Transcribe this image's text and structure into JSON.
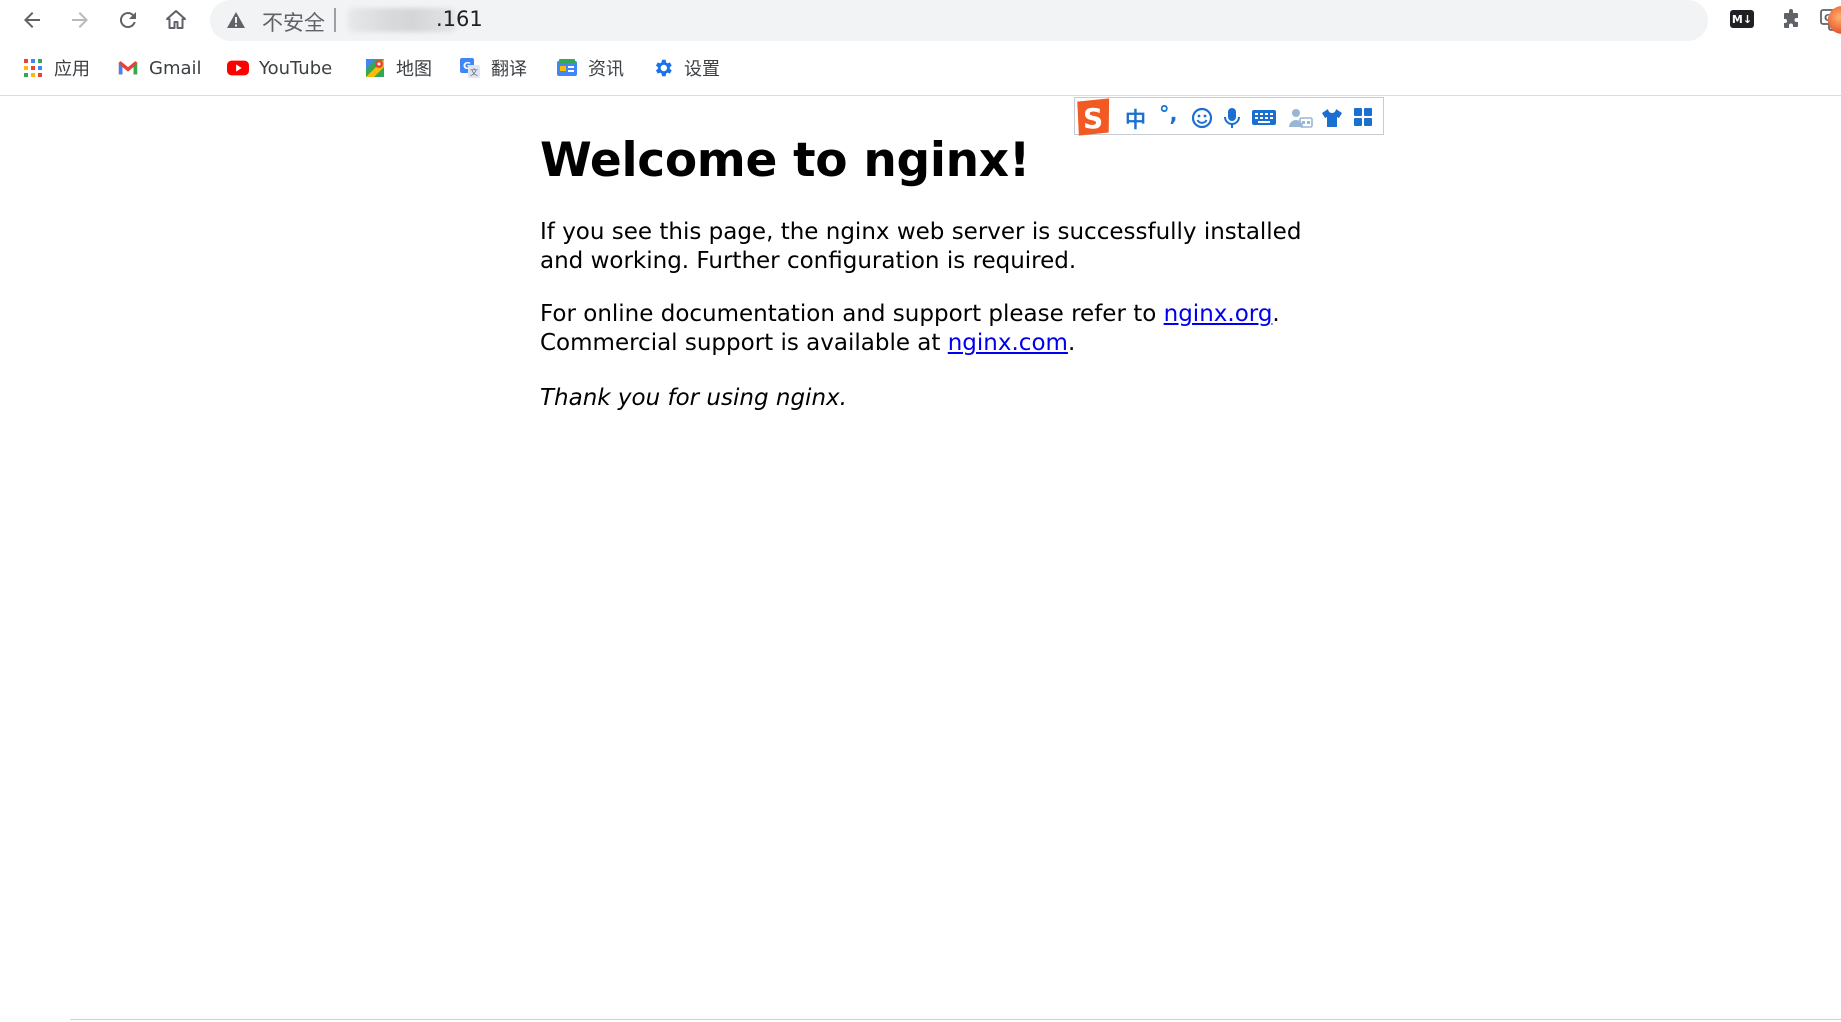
{
  "browser": {
    "address": {
      "security_label": "不安全",
      "host_visible": ".161"
    },
    "extensions": {
      "markdown_label": "M↓"
    }
  },
  "bookmarks": [
    {
      "label": "应用",
      "icon": "apps-grid-icon"
    },
    {
      "label": "Gmail",
      "icon": "gmail-icon"
    },
    {
      "label": "YouTube",
      "icon": "youtube-icon"
    },
    {
      "label": "地图",
      "icon": "maps-icon"
    },
    {
      "label": "翻译",
      "icon": "translate-icon"
    },
    {
      "label": "资讯",
      "icon": "news-icon"
    },
    {
      "label": "设置",
      "icon": "settings-gear-icon"
    }
  ],
  "ime_toolbar": {
    "mode_label": "中",
    "punct_label": "°,"
  },
  "page": {
    "heading": "Welcome to nginx!",
    "para1": "If you see this page, the nginx web server is successfully installed and working. Further configuration is required.",
    "para2_prefix": "For online documentation and support please refer to ",
    "para2_link1": "nginx.org",
    "para2_mid": ".",
    "para2_line2_prefix": "Commercial support is available at ",
    "para2_link2": "nginx.com",
    "para2_suffix": ".",
    "para3": "Thank you for using nginx."
  },
  "colors": {
    "link": "#0000ee",
    "ime_accent": "#1a6fd1",
    "sogou_orange": "#f15a22"
  }
}
